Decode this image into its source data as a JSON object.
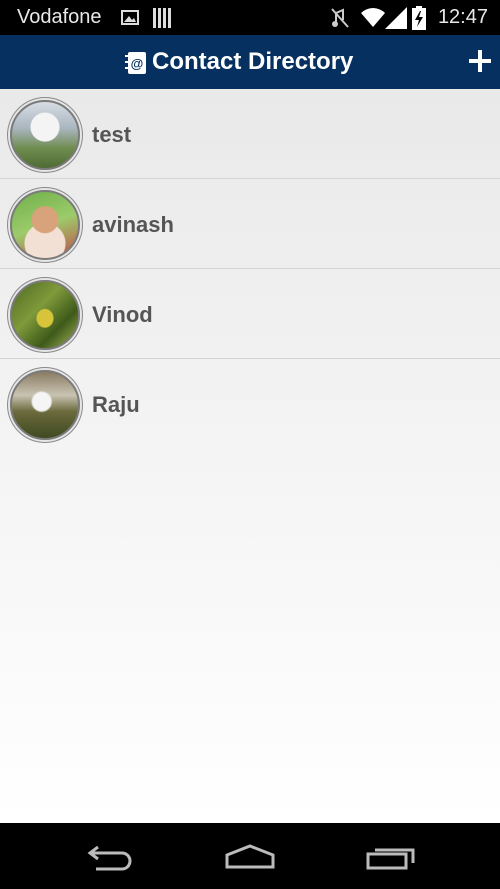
{
  "status_bar": {
    "carrier": "Vodafone",
    "time": "12:47",
    "icons": [
      "image-icon",
      "barcode-icon",
      "mute-icon",
      "wifi-icon",
      "signal-icon",
      "battery-charging-icon"
    ]
  },
  "app_bar": {
    "title": "Contact Directory",
    "app_icon": "address-book-icon",
    "action_icon": "plus-icon"
  },
  "contacts": [
    {
      "name": "test",
      "avatar": "baseball-player-photo"
    },
    {
      "name": "avinash",
      "avatar": "child-photo"
    },
    {
      "name": "Vinod",
      "avatar": "leaves-photo"
    },
    {
      "name": "Raju",
      "avatar": "waterfall-photo"
    }
  ],
  "nav_bar": {
    "icons": [
      "back-icon",
      "home-icon",
      "recent-apps-icon"
    ]
  },
  "colors": {
    "app_bar": "#06305f",
    "status_bar": "#000000",
    "name_text": "#555555"
  }
}
